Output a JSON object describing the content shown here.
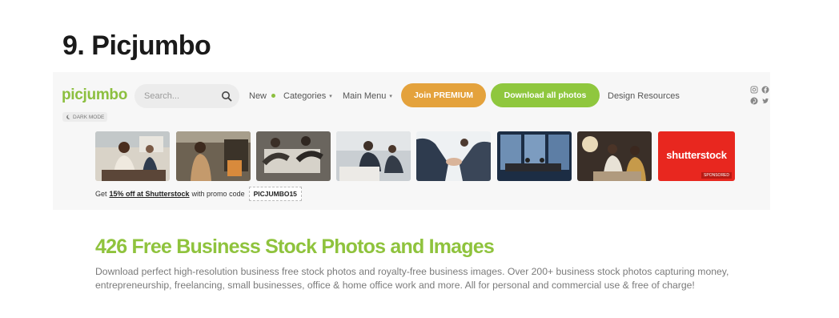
{
  "article": {
    "heading": "9. Picjumbo"
  },
  "header": {
    "logo": "picjumbo",
    "search": {
      "placeholder": "Search...",
      "value": ""
    },
    "nav": {
      "new": "New",
      "categories": "Categories",
      "main_menu": "Main Menu",
      "caret": "▾",
      "join_premium": "Join PREMIUM",
      "download_all": "Download all photos",
      "design_resources": "Design Resources"
    },
    "social_icons": [
      "instagram-icon",
      "facebook-icon",
      "pinterest-icon",
      "twitter-icon"
    ],
    "dark_mode": "DARK MODE"
  },
  "ad": {
    "sponsor_logo": "shutterstock",
    "sponsored": "SPONSORED",
    "promo_prefix": "Get",
    "promo_link": "15% off at Shutterstock",
    "promo_suffix": "with promo code",
    "promo_code": "PICJUMBO15"
  },
  "main": {
    "title": "426 Free Business Stock Photos and Images",
    "description": "Download perfect high-resolution business free stock photos and royalty-free business images. Over 200+ business stock photos capturing money, entrepreneurship, freelancing, small businesses, office & home office work and more. All for personal and commercial use & free of charge!"
  },
  "colors": {
    "brand_green": "#8cbf3f",
    "premium_orange": "#e4a23c",
    "download_green": "#8fc73e",
    "shutterstock_red": "#e8271f"
  }
}
